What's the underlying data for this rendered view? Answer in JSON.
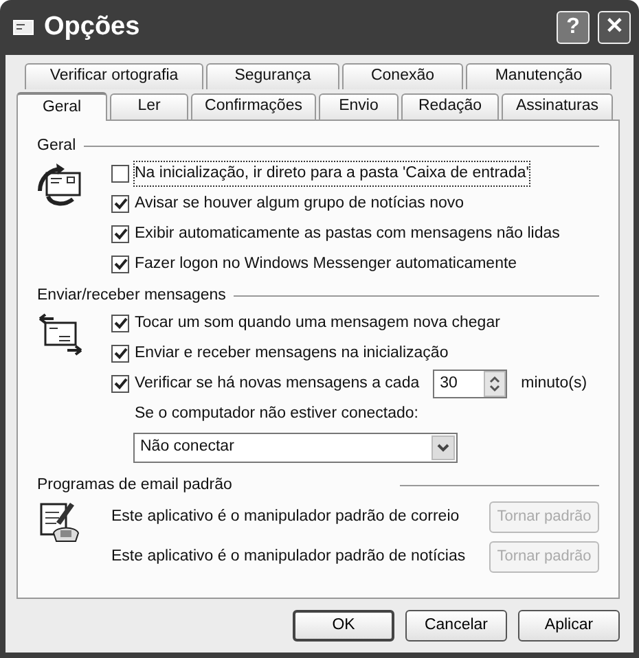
{
  "window": {
    "title": "Opções",
    "buttons": [
      "?",
      "✕"
    ]
  },
  "tab_rows": [
    [
      {
        "label": "Verificar ortografia",
        "selected": false
      },
      {
        "label": "Segurança",
        "selected": false
      },
      {
        "label": "Conexão",
        "selected": false
      },
      {
        "label": "Manutenção",
        "selected": false
      }
    ],
    [
      {
        "label": "Geral",
        "selected": true
      },
      {
        "label": "Ler",
        "selected": false
      },
      {
        "label": "Confirmações",
        "selected": false
      },
      {
        "label": "Envio",
        "selected": false
      },
      {
        "label": "Redação",
        "selected": false
      },
      {
        "label": "Assinaturas",
        "selected": false
      }
    ]
  ],
  "sections": [
    {
      "title": "Geral",
      "items": [
        {
          "kind": "checkbox",
          "label": "Na inicialização, ir direto para a pasta 'Caixa de entrada'",
          "checked": false,
          "focused": true
        },
        {
          "kind": "checkbox",
          "label": "Avisar se houver algum grupo de notícias novo",
          "checked": true
        },
        {
          "kind": "checkbox",
          "label": "Exibir automaticamente as pastas com mensagens não lidas",
          "checked": true
        },
        {
          "kind": "checkbox",
          "label": "Fazer logon no Windows Messenger automaticamente",
          "checked": true
        }
      ]
    },
    {
      "title": "Enviar/receber mensagens",
      "items": [
        {
          "kind": "checkbox",
          "label": "Tocar um som quando uma mensagem nova chegar",
          "checked": true
        },
        {
          "kind": "checkbox",
          "label": "Enviar e receber mensagens na inicialização",
          "checked": true
        },
        {
          "kind": "interval",
          "label": "Verificar se há novas mensagens a cada",
          "checked": true,
          "value": "30",
          "unit": "minuto(s)"
        },
        {
          "kind": "label",
          "label": "Se o computador não estiver conectado:"
        },
        {
          "kind": "select",
          "value": "Não conectar"
        }
      ]
    },
    {
      "title": "Programas de email padrão",
      "items": [
        {
          "kind": "handler",
          "label": "Este aplicativo é o manipulador padrão de correio",
          "button": "Tornar padrão",
          "disabled": true
        },
        {
          "kind": "handler",
          "label": "Este aplicativo é o manipulador padrão de notícias",
          "button": "Tornar padrão",
          "disabled": true
        }
      ]
    }
  ],
  "buttons": [
    {
      "label": "OK",
      "default": true
    },
    {
      "label": "Cancelar",
      "default": false
    },
    {
      "label": "Aplicar",
      "default": false
    }
  ]
}
